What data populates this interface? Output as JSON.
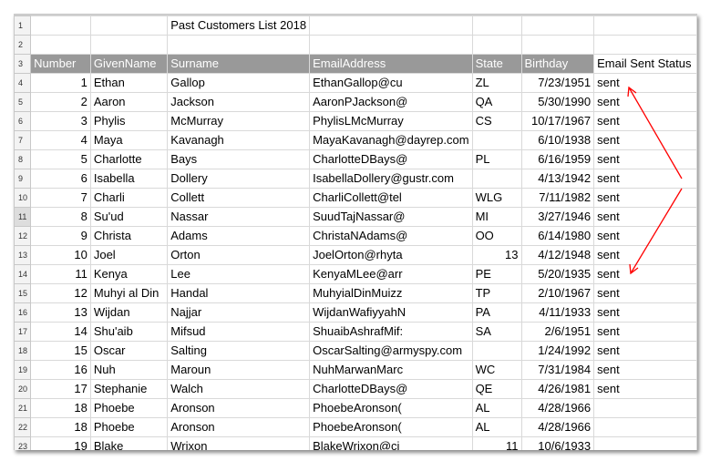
{
  "title": "Past Customers List 2018",
  "headers": [
    "Number",
    "GivenName",
    "Surname",
    "EmailAddress",
    "State",
    "Birthday",
    "Email Sent Status"
  ],
  "rows": [
    [
      "1",
      "Ethan",
      "Gallop",
      "EthanGallop@cu",
      "ZL",
      "",
      "7/23/1951",
      "sent"
    ],
    [
      "2",
      "Aaron",
      "Jackson",
      "AaronPJackson@",
      "QA",
      "",
      "5/30/1990",
      "sent"
    ],
    [
      "3",
      "Phylis",
      "McMurray",
      "PhylisLMcMurray",
      "CS",
      "",
      "10/17/1967",
      "sent"
    ],
    [
      "4",
      "Maya",
      "Kavanagh",
      "MayaKavanagh@dayrep.com",
      "",
      "",
      "6/10/1938",
      "sent"
    ],
    [
      "5",
      "Charlotte",
      "Bays",
      "CharlotteDBays@",
      "PL",
      "",
      "6/16/1959",
      "sent"
    ],
    [
      "6",
      "Isabella",
      "Dollery",
      "IsabellaDollery@gustr.com",
      "",
      "",
      "4/13/1942",
      "sent"
    ],
    [
      "7",
      "Charli",
      "Collett",
      "CharliCollett@tel",
      "WLG",
      "",
      "7/11/1982",
      "sent"
    ],
    [
      "8",
      "Su'ud",
      "Nassar",
      "SuudTajNassar@",
      "MI",
      "",
      "3/27/1946",
      "sent"
    ],
    [
      "9",
      "Christa",
      "Adams",
      "ChristaNAdams@",
      "OO",
      "",
      "6/14/1980",
      "sent"
    ],
    [
      "10",
      "Joel",
      "Orton",
      "JoelOrton@rhyta",
      "",
      "13",
      "4/12/1948",
      "sent"
    ],
    [
      "11",
      "Kenya",
      "Lee",
      "KenyaMLee@arr",
      "PE",
      "",
      "5/20/1935",
      "sent"
    ],
    [
      "12",
      "Muhyi al Din",
      "Handal",
      "MuhyialDinMuizz",
      "TP",
      "",
      "2/10/1967",
      "sent"
    ],
    [
      "13",
      "Wijdan",
      "Najjar",
      "WijdanWafiyyahN",
      "PA",
      "",
      "4/11/1933",
      "sent"
    ],
    [
      "14",
      "Shu'aib",
      "Mifsud",
      "ShuaibAshrafMif:",
      "SA",
      "",
      "2/6/1951",
      "sent"
    ],
    [
      "15",
      "Oscar",
      "Salting",
      "OscarSalting@armyspy.com",
      "",
      "",
      "1/24/1992",
      "sent"
    ],
    [
      "16",
      "Nuh",
      "Maroun",
      "NuhMarwanMarc",
      "WC",
      "",
      "7/31/1984",
      "sent"
    ],
    [
      "17",
      "Stephanie",
      "Walch",
      "CharlotteDBays@",
      "QE",
      "",
      "4/26/1981",
      "sent"
    ],
    [
      "18",
      "Phoebe",
      "Aronson",
      "PhoebeAronson(",
      "AL",
      "",
      "4/28/1966",
      ""
    ],
    [
      "18",
      "Phoebe",
      "Aronson",
      "PhoebeAronson(",
      "AL",
      "",
      "4/28/1966",
      ""
    ],
    [
      "19",
      "Blake",
      "Wrixon",
      "BlakeWrixon@ci",
      "",
      "11",
      "10/6/1933",
      ""
    ]
  ],
  "annotation_color": "#ff0000"
}
